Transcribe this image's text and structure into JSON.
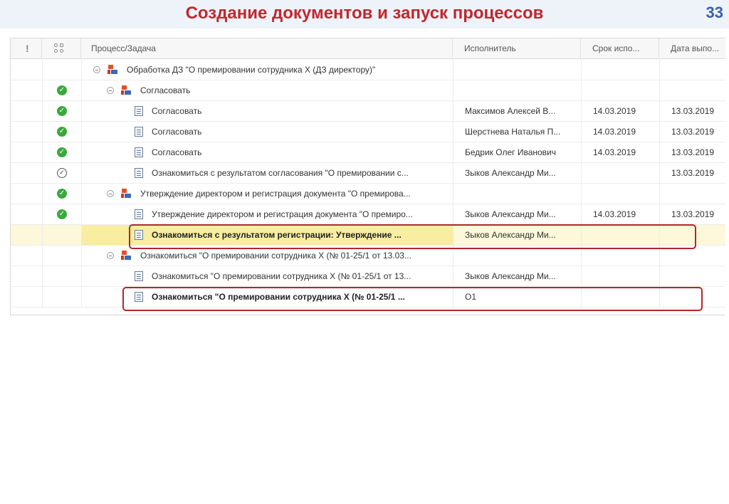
{
  "slide": {
    "title": "Создание документов и запуск процессов",
    "number": "33"
  },
  "columns": {
    "importance_icon": "exclamation-icon",
    "status_icon": "status-icon",
    "task": "Процесс/Задача",
    "executor": "Исполнитель",
    "due": "Срок испо...",
    "done": "Дата выпо..."
  },
  "rows": [
    {
      "level": 0,
      "kind": "process",
      "status": "",
      "task": "Обработка ДЗ \"О премировании сотрудника Х (ДЗ директору)\"",
      "executor": "",
      "due": "",
      "done": ""
    },
    {
      "level": 1,
      "kind": "process",
      "status": "done",
      "task": "Согласовать",
      "executor": "",
      "due": "",
      "done": ""
    },
    {
      "level": 2,
      "kind": "task",
      "status": "done",
      "task": "Согласовать",
      "executor": "Максимов Алексей В...",
      "due": "14.03.2019",
      "done": "13.03.2019"
    },
    {
      "level": 2,
      "kind": "task",
      "status": "done",
      "task": "Согласовать",
      "executor": "Шерстнева Наталья П...",
      "due": "14.03.2019",
      "done": "13.03.2019"
    },
    {
      "level": 2,
      "kind": "task",
      "status": "done",
      "task": "Согласовать",
      "executor": "Бедрик Олег Иванович",
      "due": "14.03.2019",
      "done": "13.03.2019"
    },
    {
      "level": 2,
      "kind": "task",
      "status": "acknowledged",
      "task": "Ознакомиться с результатом согласования \"О премировании с...",
      "executor": "Зыков Александр Ми...",
      "due": "",
      "done": "13.03.2019"
    },
    {
      "level": 1,
      "kind": "process",
      "status": "done",
      "task": "Утверждение директором и регистрация документа \"О премирова...",
      "executor": "",
      "due": "",
      "done": ""
    },
    {
      "level": 2,
      "kind": "task",
      "status": "done",
      "task": "Утверждение директором и регистрация документа \"О премиро...",
      "executor": "Зыков Александр Ми...",
      "due": "14.03.2019",
      "done": "13.03.2019"
    },
    {
      "level": 2,
      "kind": "task",
      "status": "",
      "bold": true,
      "selected": true,
      "task": "Ознакомиться с результатом регистрации: Утверждение ...",
      "executor": "Зыков Александр Ми...",
      "due": "",
      "done": ""
    },
    {
      "level": 1,
      "kind": "process",
      "status": "",
      "task": "Ознакомиться \"О премировании сотрудника Х (№ 01-25/1 от 13.03...",
      "executor": "",
      "due": "",
      "done": ""
    },
    {
      "level": 2,
      "kind": "task",
      "status": "",
      "task": "Ознакомиться \"О премировании сотрудника Х (№ 01-25/1 от 13...",
      "executor": "Зыков Александр Ми...",
      "due": "",
      "done": ""
    },
    {
      "level": 2,
      "kind": "task",
      "status": "",
      "bold": true,
      "task": "Ознакомиться \"О премировании сотрудника Х (№ 01-25/1 ...",
      "executor": "О1",
      "due": "",
      "done": ""
    }
  ],
  "colors": {
    "title": "#c0282e",
    "slide_number": "#3a5fa8",
    "check": "#3aa93c",
    "highlight_border": "#b3262b",
    "selected_row": "#fcf8d9"
  }
}
